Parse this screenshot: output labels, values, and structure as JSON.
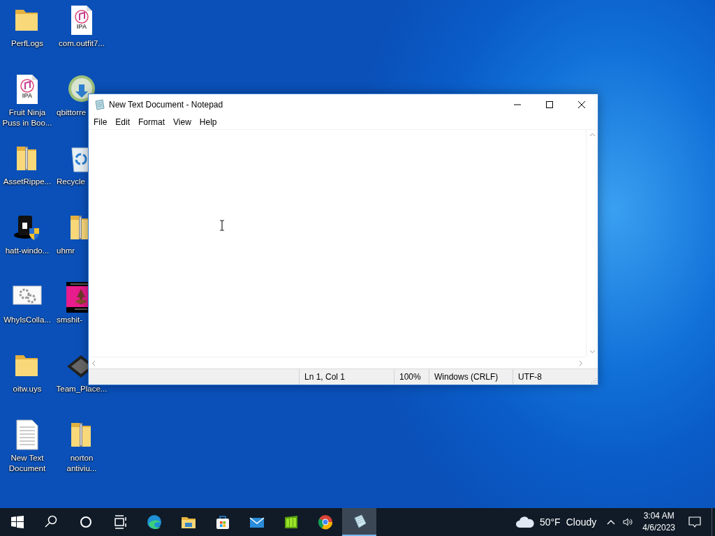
{
  "desktop": {
    "icons": [
      {
        "kind": "folder",
        "label": "PerfLogs",
        "cut": false
      },
      {
        "kind": "ipa",
        "label": "com.outfit7...",
        "badge": "IPA",
        "cut": false
      },
      {
        "kind": "ipa",
        "label": "Fruit Ninja Puss in Boo...",
        "badge": "IPA",
        "cut": false
      },
      {
        "kind": "torrent",
        "label": "qbittorre",
        "cut": true
      },
      {
        "kind": "zip",
        "label": "AssetRippe...",
        "cut": false
      },
      {
        "kind": "recycle",
        "label": "Recycle",
        "cut": true
      },
      {
        "kind": "hat",
        "label": "hatt-windo...",
        "cut": false
      },
      {
        "kind": "zip",
        "label": "uhmr",
        "cut": true
      },
      {
        "kind": "gears",
        "label": "WhyIsColla...",
        "cut": false
      },
      {
        "kind": "picture",
        "label": "smshit-",
        "cut": true
      },
      {
        "kind": "folder",
        "label": "oitw.uys",
        "cut": false
      },
      {
        "kind": "diamond",
        "label": "Team_Place...",
        "cut": false
      },
      {
        "kind": "text",
        "label": "New Text Document",
        "cut": false
      },
      {
        "kind": "zip",
        "label": "norton antiviu...",
        "cut": false
      }
    ]
  },
  "window": {
    "title": "New Text Document - Notepad",
    "menu": [
      "File",
      "Edit",
      "Format",
      "View",
      "Help"
    ],
    "status_bar": [
      "Ln 1, Col 1",
      "100%",
      "Windows (CRLF)",
      "UTF-8"
    ]
  },
  "taskbar": {
    "apps": [
      {
        "kind": "start",
        "selected": false
      },
      {
        "kind": "search",
        "selected": false
      },
      {
        "kind": "cortana",
        "selected": false
      },
      {
        "kind": "taskview",
        "selected": false
      },
      {
        "kind": "edge",
        "selected": false
      },
      {
        "kind": "explorer",
        "selected": false
      },
      {
        "kind": "store",
        "selected": false
      },
      {
        "kind": "mail",
        "selected": false
      },
      {
        "kind": "green",
        "selected": false
      },
      {
        "kind": "chrome",
        "selected": false
      },
      {
        "kind": "notepad",
        "selected": true
      }
    ],
    "weather": {
      "temperature": "50°F",
      "condition": "Cloudy"
    },
    "clock": {
      "time": "3:04 AM",
      "date": "4/6/2023"
    }
  }
}
